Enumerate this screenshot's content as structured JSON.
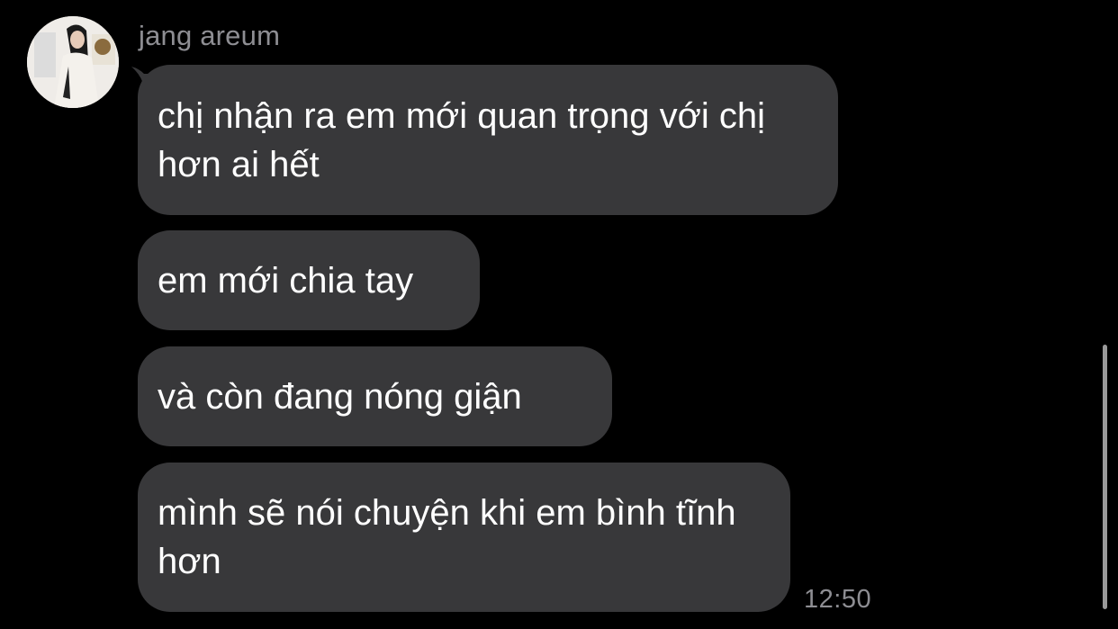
{
  "chat": {
    "sender_name": "jang areum",
    "messages": [
      {
        "text": "chị nhận ra em mới quan trọng với chị hơn ai hết"
      },
      {
        "text": "em mới chia tay"
      },
      {
        "text": "và còn đang nóng giận"
      },
      {
        "text": "mình sẽ nói chuyện khi em bình tĩnh hơn"
      }
    ],
    "timestamp": "12:50"
  },
  "colors": {
    "background": "#000000",
    "bubble": "#38383a",
    "secondary_text": "#8e8e93"
  }
}
